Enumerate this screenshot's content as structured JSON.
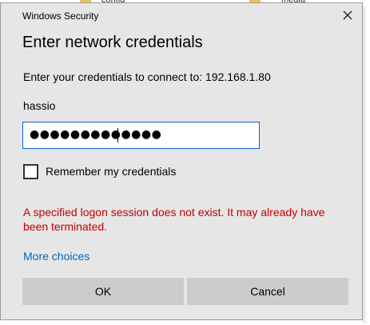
{
  "background": {
    "folder_labels": [
      "config",
      "media"
    ]
  },
  "dialog": {
    "window_title": "Windows Security",
    "heading": "Enter network credentials",
    "connect_prompt": "Enter your credentials to connect to: 192.168.1.80",
    "username": "hassio",
    "password_masked": "●●●●●●●●●●●●●",
    "remember_label": "Remember my credentials",
    "remember_checked": false,
    "error_message": "A specified logon session does not exist. It may already have been terminated.",
    "more_choices_label": "More choices",
    "ok_label": "OK",
    "cancel_label": "Cancel"
  },
  "colors": {
    "dialog_bg": "#e6e6e6",
    "input_border": "#0a64c8",
    "error": "#c00000",
    "link": "#0067c0",
    "button_bg": "#cccccc"
  },
  "icons": {
    "close": "close-icon"
  }
}
